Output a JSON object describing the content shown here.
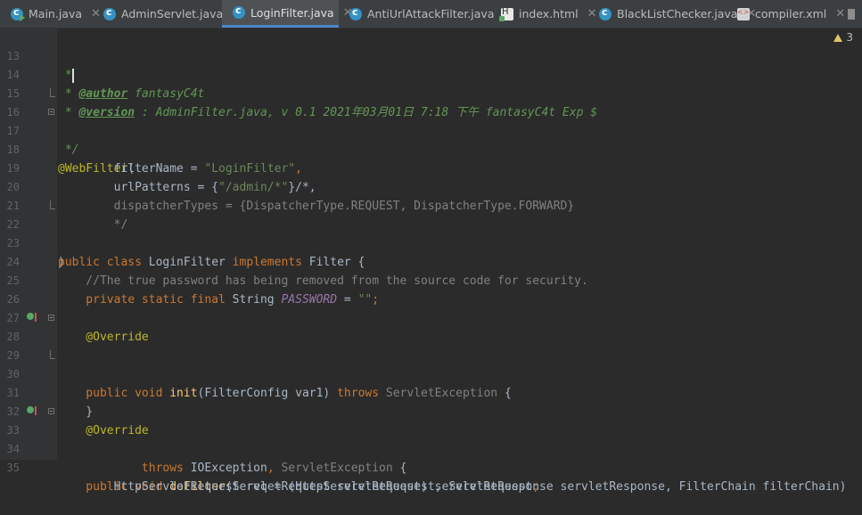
{
  "tabs": [
    {
      "label": "Main.java",
      "icon": "java-class-main-icon",
      "active": false
    },
    {
      "label": "AdminServlet.java",
      "icon": "java-class-icon",
      "active": false
    },
    {
      "label": "LoginFilter.java",
      "icon": "java-class-icon",
      "active": true
    },
    {
      "label": "AntiUrlAttackFilter.java",
      "icon": "java-class-icon",
      "active": false
    },
    {
      "label": "index.html",
      "icon": "html-file-icon",
      "active": false
    },
    {
      "label": "BlackListChecker.java",
      "icon": "java-class-icon",
      "active": false
    },
    {
      "label": "compiler.xml",
      "icon": "xml-file-icon",
      "active": false
    }
  ],
  "inspection": {
    "warning_count": "3"
  },
  "line_numbers": [
    "13",
    "14",
    "15",
    "16",
    "17",
    "18",
    "19",
    "20",
    "21",
    "22",
    "23",
    "24",
    "25",
    "26",
    "27",
    "28",
    "29",
    "30",
    "31",
    "32",
    "33",
    "34",
    "35"
  ],
  "code": {
    "l13": " *",
    "l14_a": " * ",
    "l14_tag": "@author",
    "l14_b": " fantasyC4t",
    "l15_a": " * ",
    "l15_tag": "@version",
    "l15_b": " : AdminFilter.java, v 0.1 2021年03月01日 7:18 下午 fantasyC4t Exp $",
    "l16": " */",
    "l17": "@WebFilter",
    "l17_p": "(",
    "l18_a": "        filterName = ",
    "l18_s": "\"LoginFilter\"",
    "l18_c": ",",
    "l19_a": "        urlPatterns = {",
    "l19_s": "\"/admin/*\"",
    "l19_c": "}/*,",
    "l20": "        dispatcherTypes = {DispatcherType.REQUEST, DispatcherType.FORWARD}",
    "l21": "        */",
    "l22": ")",
    "l23_k1": "public class ",
    "l23_n": "LoginFilter ",
    "l23_k2": "implements ",
    "l23_t": "Filter {",
    "l24": "    //The true password has being removed from the source code for security.",
    "l25_k": "    private static final ",
    "l25_t": "String ",
    "l25_c": "PASSWORD",
    "l25_e": " = ",
    "l25_s": "\"\"",
    "l25_sc": ";",
    "l27": "    @Override",
    "l28_k": "    public void ",
    "l28_f": "init",
    "l28_p": "(FilterConfig var1) ",
    "l28_th": "throws ",
    "l28_ex": "ServletException",
    "l28_b": " {",
    "l30": "    }",
    "l32": "    @Override",
    "l33_k": "    public void ",
    "l33_f": "doFilter",
    "l33_p": "(ServletRequest servletRequest, ServletResponse servletResponse, FilterChain filterChain)",
    "l34_th": "            throws ",
    "l34_e1": "IOException",
    "l34_cm": ", ",
    "l34_e2": "ServletException",
    "l34_b": " {",
    "l35_a": "        HttpServletRequest req = (HttpServletRequest) servletRequest",
    "l35_sc": ";"
  }
}
